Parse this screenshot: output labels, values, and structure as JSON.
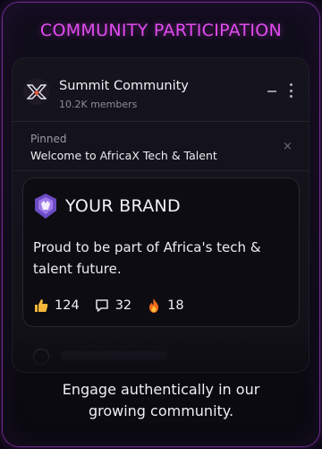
{
  "heading": "COMMUNITY PARTICIPATION",
  "community": {
    "name": "Summit Community",
    "members": "10.2K members",
    "collapse_icon": "minimize-icon",
    "menu_icon": "more-vertical-icon"
  },
  "pinned": {
    "label": "Pinned",
    "text": "Welcome to AfricaX Tech & Talent",
    "close_glyph": "×"
  },
  "post": {
    "brand_name": "YOUR BRAND",
    "body": "Proud to be part of Africa's tech & talent future.",
    "reactions": [
      {
        "icon": "thumbs-up-icon",
        "count": "124"
      },
      {
        "icon": "comment-icon",
        "count": "32"
      },
      {
        "icon": "fire-icon",
        "count": "18"
      }
    ]
  },
  "tagline_line1": "Engage authentically in our",
  "tagline_line2": "growing community.",
  "colors": {
    "accent": "#e24bf0",
    "card": "#15131c",
    "post": "#0d0c12",
    "thumb": "#f5b63a",
    "fire": "#f26a1b"
  }
}
